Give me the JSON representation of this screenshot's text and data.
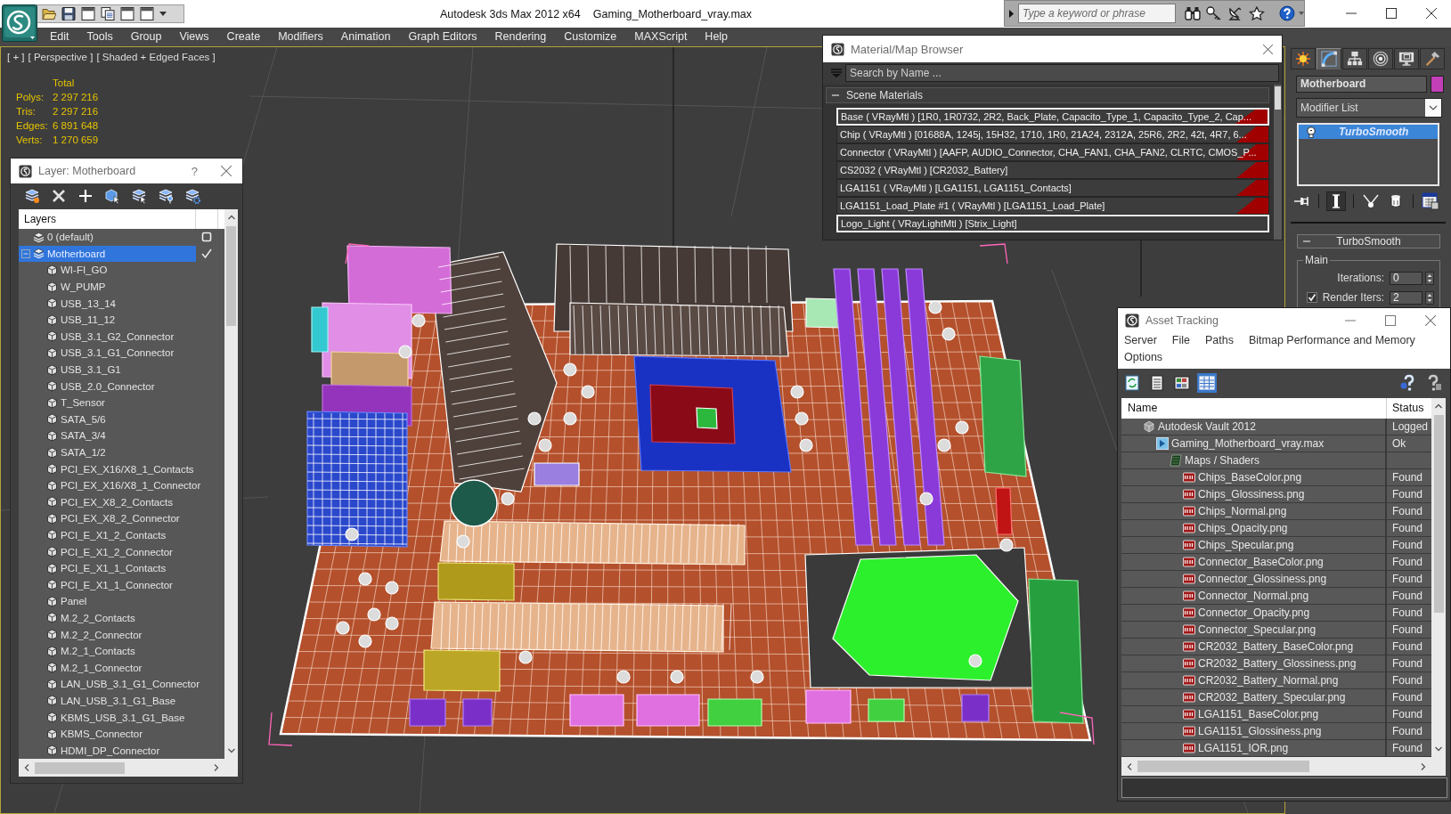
{
  "title_bar": {
    "app_title": "Autodesk 3ds Max 2012 x64",
    "file_name": "Gaming_Motherboard_vray.max",
    "search": {
      "placeholder": "Type a keyword or phrase"
    }
  },
  "menu_bar": [
    "Edit",
    "Tools",
    "Group",
    "Views",
    "Create",
    "Modifiers",
    "Animation",
    "Graph Editors",
    "Rendering",
    "Customize",
    "MAXScript",
    "Help"
  ],
  "viewport": {
    "labels": [
      "[ + ]",
      "[ Perspective ]",
      "[ Shaded + Edged Faces ]"
    ],
    "stats": {
      "heading": "Total",
      "rows": [
        {
          "label": "Polys:",
          "value": "2 297 216"
        },
        {
          "label": "Tris:",
          "value": "2 297 216"
        },
        {
          "label": "Edges:",
          "value": "6 891 648"
        },
        {
          "label": "Verts:",
          "value": "1 270 659"
        }
      ]
    }
  },
  "layer_dialog": {
    "title": "Layer: Motherboard",
    "help": "?",
    "column": "Layers",
    "layers": [
      {
        "name": "0 (default)",
        "kind": "layer",
        "selected": false,
        "current": false
      },
      {
        "name": "Motherboard",
        "kind": "layer",
        "selected": true,
        "current": true,
        "expanded": true,
        "children": [
          {
            "name": "WI-FI_GO",
            "kind": "object",
            "selected": false
          },
          {
            "name": "W_PUMP",
            "kind": "object",
            "selected": false
          },
          {
            "name": "USB_13_14",
            "kind": "object",
            "selected": false
          },
          {
            "name": "USB_11_12",
            "kind": "object",
            "selected": false
          },
          {
            "name": "USB_3.1_G2_Connector",
            "kind": "object",
            "selected": false
          },
          {
            "name": "USB_3.1_G1_Connector",
            "kind": "object",
            "selected": false
          },
          {
            "name": "USB_3.1_G1",
            "kind": "object",
            "selected": false
          },
          {
            "name": "USB_2.0_Connector",
            "kind": "object",
            "selected": false
          },
          {
            "name": "T_Sensor",
            "kind": "object",
            "selected": false
          },
          {
            "name": "SATA_5/6",
            "kind": "object",
            "selected": false
          },
          {
            "name": "SATA_3/4",
            "kind": "object",
            "selected": false
          },
          {
            "name": "SATA_1/2",
            "kind": "object",
            "selected": false
          },
          {
            "name": "PCI_EX_X16/X8_1_Contacts",
            "kind": "object",
            "selected": false
          },
          {
            "name": "PCI_EX_X16/X8_1_Connector",
            "kind": "object",
            "selected": false
          },
          {
            "name": "PCI_EX_X8_2_Contacts",
            "kind": "object",
            "selected": false
          },
          {
            "name": "PCI_EX_X8_2_Connector",
            "kind": "object",
            "selected": false
          },
          {
            "name": "PCI_E_X1_2_Contacts",
            "kind": "object",
            "selected": false
          },
          {
            "name": "PCI_E_X1_2_Connector",
            "kind": "object",
            "selected": false
          },
          {
            "name": "PCI_E_X1_1_Contacts",
            "kind": "object",
            "selected": false
          },
          {
            "name": "PCI_E_X1_1_Connector",
            "kind": "object",
            "selected": false
          },
          {
            "name": "Panel",
            "kind": "object",
            "selected": false
          },
          {
            "name": "M.2_2_Contacts",
            "kind": "object",
            "selected": false
          },
          {
            "name": "M.2_2_Connector",
            "kind": "object",
            "selected": false
          },
          {
            "name": "M.2_1_Contacts",
            "kind": "object",
            "selected": false
          },
          {
            "name": "M.2_1_Connector",
            "kind": "object",
            "selected": false
          },
          {
            "name": "LAN_USB_3.1_G1_Connector",
            "kind": "object",
            "selected": false
          },
          {
            "name": "LAN_USB_3.1_G1_Base",
            "kind": "object",
            "selected": false
          },
          {
            "name": "KBMS_USB_3.1_G1_Base",
            "kind": "object",
            "selected": false
          },
          {
            "name": "KBMS_Connector",
            "kind": "object",
            "selected": false
          },
          {
            "name": "HDMI_DP_Connector",
            "kind": "object",
            "selected": false
          }
        ]
      }
    ]
  },
  "material_browser": {
    "title": "Material/Map Browser",
    "search": {
      "placeholder": "Search by Name ..."
    },
    "group": {
      "label": "Scene Materials",
      "expanded": true
    },
    "materials": [
      {
        "text": "Base ( VRayMtl ) [1R0, 1R0732, 2R2, Back_Plate, Capacito_Type_1, Capacito_Type_2, Cap...",
        "selected": true,
        "flagged": true
      },
      {
        "text": "Chip ( VRayMtl ) [01688A, 1245j, 15H32, 1710, 1R0, 21A24, 2312A, 25R6, 2R2, 42t, 4R7, 6...",
        "selected": false,
        "flagged": true
      },
      {
        "text": "Connector ( VRayMtl ) [AAFP, AUDIO_Connector, CHA_FAN1, CHA_FAN2, CLRTC, CMOS_P...",
        "selected": false,
        "flagged": true
      },
      {
        "text": "CS2032 ( VRayMtl ) [CR2032_Battery]",
        "selected": false,
        "flagged": true
      },
      {
        "text": "LGA1151 ( VRayMtl ) [LGA1151, LGA1151_Contacts]",
        "selected": false,
        "flagged": true
      },
      {
        "text": "LGA1151_Load_Plate #1 ( VRayMtl ) [LGA1151_Load_Plate]",
        "selected": false,
        "flagged": true
      },
      {
        "text": "Logo_Light ( VRayLightMtl ) [Strix_Light]",
        "selected": true,
        "flagged": false
      }
    ]
  },
  "command_panel": {
    "tabs": [
      {
        "kind": "create",
        "selected": false
      },
      {
        "kind": "modify",
        "selected": true
      },
      {
        "kind": "hierarchy",
        "selected": false
      },
      {
        "kind": "motion",
        "selected": false
      },
      {
        "kind": "display",
        "selected": false
      },
      {
        "kind": "utilities",
        "selected": false
      }
    ],
    "object_name": "Motherboard",
    "modifier_list": "Modifier List",
    "stack": [
      {
        "name": "TurboSmooth",
        "selected": true
      }
    ],
    "stack_tools": [
      {
        "kind": "pin",
        "selected": false
      },
      {
        "kind": "end_result",
        "selected": true
      },
      {
        "kind": "make_unique",
        "selected": false
      },
      {
        "kind": "remove",
        "selected": false
      },
      {
        "kind": "configure",
        "selected": false
      }
    ],
    "rollout": {
      "title": "TurboSmooth",
      "expanded": true,
      "group": "Main",
      "fields": [
        {
          "kind": "spinner",
          "label": "Iterations:",
          "value": "0"
        },
        {
          "kind": "check_spinner",
          "label": "Render Iters:",
          "value": "2",
          "checked": true
        }
      ]
    }
  },
  "asset_tracking": {
    "title": "Asset Tracking",
    "menu": [
      "Server",
      "File",
      "Paths",
      "Bitmap Performance and Memory",
      "Options"
    ],
    "toolbar": [
      {
        "kind": "refresh",
        "selected": false
      },
      {
        "kind": "list",
        "selected": false
      },
      {
        "kind": "thumbnails",
        "selected": false
      },
      {
        "kind": "table",
        "selected": true
      },
      {
        "kind": "help",
        "selected": false
      },
      {
        "kind": "help_tool",
        "selected": false
      }
    ],
    "columns": [
      "Name",
      "Status"
    ],
    "rows": [
      {
        "name": "Autodesk Vault 2012",
        "kind": "vault",
        "status": "Logged",
        "selected": false,
        "children": [
          {
            "name": "Gaming_Motherboard_vray.max",
            "kind": "scene",
            "status": "Ok",
            "selected": false,
            "children": [
              {
                "name": "Maps / Shaders",
                "kind": "folder",
                "selected": false,
                "children": [
                  {
                    "name": "Chips_BaseColor.png",
                    "kind": "image",
                    "status": "Found",
                    "selected": false
                  },
                  {
                    "name": "Chips_Glossiness.png",
                    "kind": "image",
                    "status": "Found",
                    "selected": false
                  },
                  {
                    "name": "Chips_Normal.png",
                    "kind": "image",
                    "status": "Found",
                    "selected": false
                  },
                  {
                    "name": "Chips_Opacity.png",
                    "kind": "image",
                    "status": "Found",
                    "selected": false
                  },
                  {
                    "name": "Chips_Specular.png",
                    "kind": "image",
                    "status": "Found",
                    "selected": false
                  },
                  {
                    "name": "Connector_BaseColor.png",
                    "kind": "image",
                    "status": "Found",
                    "selected": false
                  },
                  {
                    "name": "Connector_Glossiness.png",
                    "kind": "image",
                    "status": "Found",
                    "selected": false
                  },
                  {
                    "name": "Connector_Normal.png",
                    "kind": "image",
                    "status": "Found",
                    "selected": false
                  },
                  {
                    "name": "Connector_Opacity.png",
                    "kind": "image",
                    "status": "Found",
                    "selected": false
                  },
                  {
                    "name": "Connector_Specular.png",
                    "kind": "image",
                    "status": "Found",
                    "selected": false
                  },
                  {
                    "name": "CR2032_Battery_BaseColor.png",
                    "kind": "image",
                    "status": "Found",
                    "selected": false
                  },
                  {
                    "name": "CR2032_Battery_Glossiness.png",
                    "kind": "image",
                    "status": "Found",
                    "selected": false
                  },
                  {
                    "name": "CR2032_Battery_Normal.png",
                    "kind": "image",
                    "status": "Found",
                    "selected": false
                  },
                  {
                    "name": "CR2032_Battery_Specular.png",
                    "kind": "image",
                    "status": "Found",
                    "selected": false
                  },
                  {
                    "name": "LGA1151_BaseColor.png",
                    "kind": "image",
                    "status": "Found",
                    "selected": false
                  },
                  {
                    "name": "LGA1151_Glossiness.png",
                    "kind": "image",
                    "status": "Found",
                    "selected": false
                  },
                  {
                    "name": "LGA1151_IOR.png",
                    "kind": "image",
                    "status": "Found",
                    "selected": false
                  }
                ]
              }
            ]
          }
        ]
      }
    ]
  }
}
